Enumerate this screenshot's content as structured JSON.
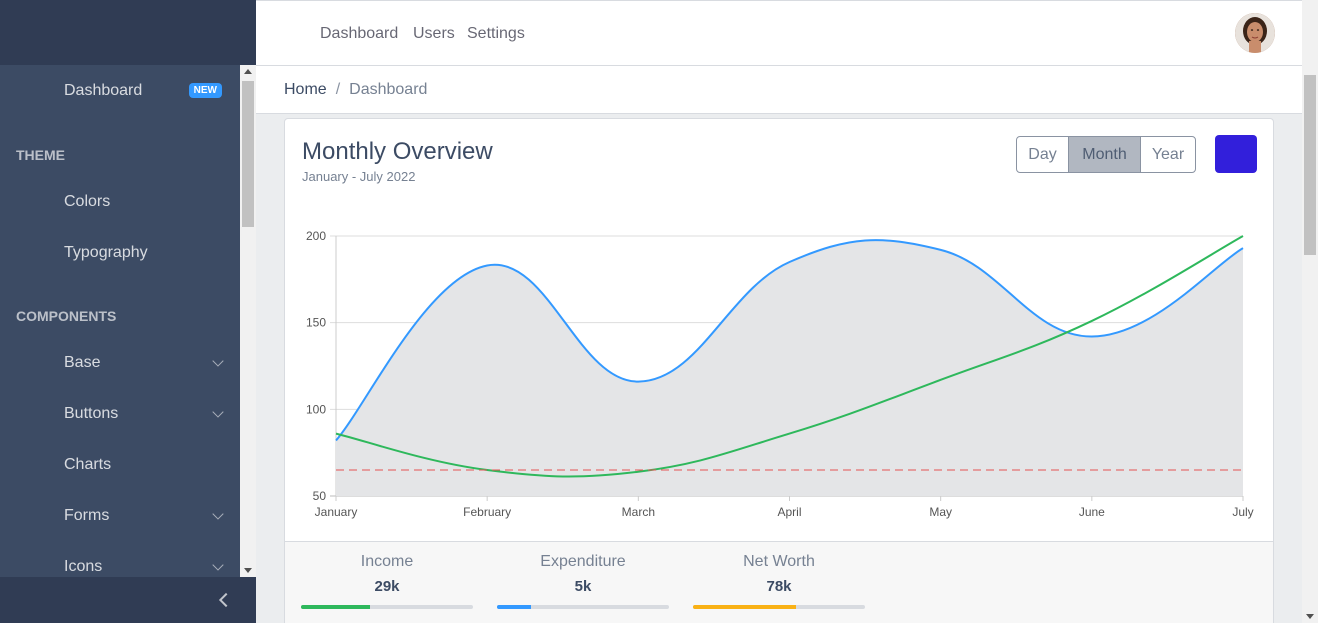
{
  "header": {
    "nav": [
      "Dashboard",
      "Users",
      "Settings"
    ]
  },
  "sidebar": {
    "dashboard": {
      "label": "Dashboard",
      "badge": "NEW"
    },
    "sections": [
      {
        "title": "THEME"
      },
      {
        "title": "COMPONENTS"
      }
    ],
    "items": [
      {
        "label": "Colors",
        "expandable": false
      },
      {
        "label": "Typography",
        "expandable": false
      },
      {
        "label": "Base",
        "expandable": true
      },
      {
        "label": "Buttons",
        "expandable": true
      },
      {
        "label": "Charts",
        "expandable": false
      },
      {
        "label": "Forms",
        "expandable": true
      },
      {
        "label": "Icons",
        "expandable": true
      }
    ]
  },
  "breadcrumb": {
    "home": "Home",
    "separator": "/",
    "current": "Dashboard"
  },
  "card": {
    "title": "Monthly Overview",
    "subtitle": "January - July 2022",
    "range_buttons": [
      "Day",
      "Month",
      "Year"
    ],
    "active_range": "Month",
    "color_button": "#321fdb"
  },
  "chart_data": {
    "type": "line",
    "x": [
      "January",
      "February",
      "March",
      "April",
      "May",
      "June",
      "July"
    ],
    "y_ticks": [
      50,
      100,
      150,
      200
    ],
    "ylim": [
      50,
      200
    ],
    "grid": true,
    "series": [
      {
        "values": [
          82,
          183,
          116,
          185,
          192,
          142,
          193
        ],
        "color": "#39f",
        "fill": "#e4e5e7",
        "style": "area"
      },
      {
        "values": [
          86,
          65,
          64,
          86,
          117,
          151,
          200
        ],
        "color": "#2eb85c",
        "style": "line"
      },
      {
        "values": [
          65,
          65,
          65,
          65,
          65,
          65,
          65
        ],
        "color": "#e55353",
        "style": "dashed"
      }
    ]
  },
  "stats": [
    {
      "label": "Income",
      "value": "29k",
      "percent": 40,
      "color": "#2eb85c"
    },
    {
      "label": "Expenditure",
      "value": "5k",
      "percent": 20,
      "color": "#39f"
    },
    {
      "label": "Net Worth",
      "value": "78k",
      "percent": 60,
      "color": "#f9b115"
    }
  ]
}
